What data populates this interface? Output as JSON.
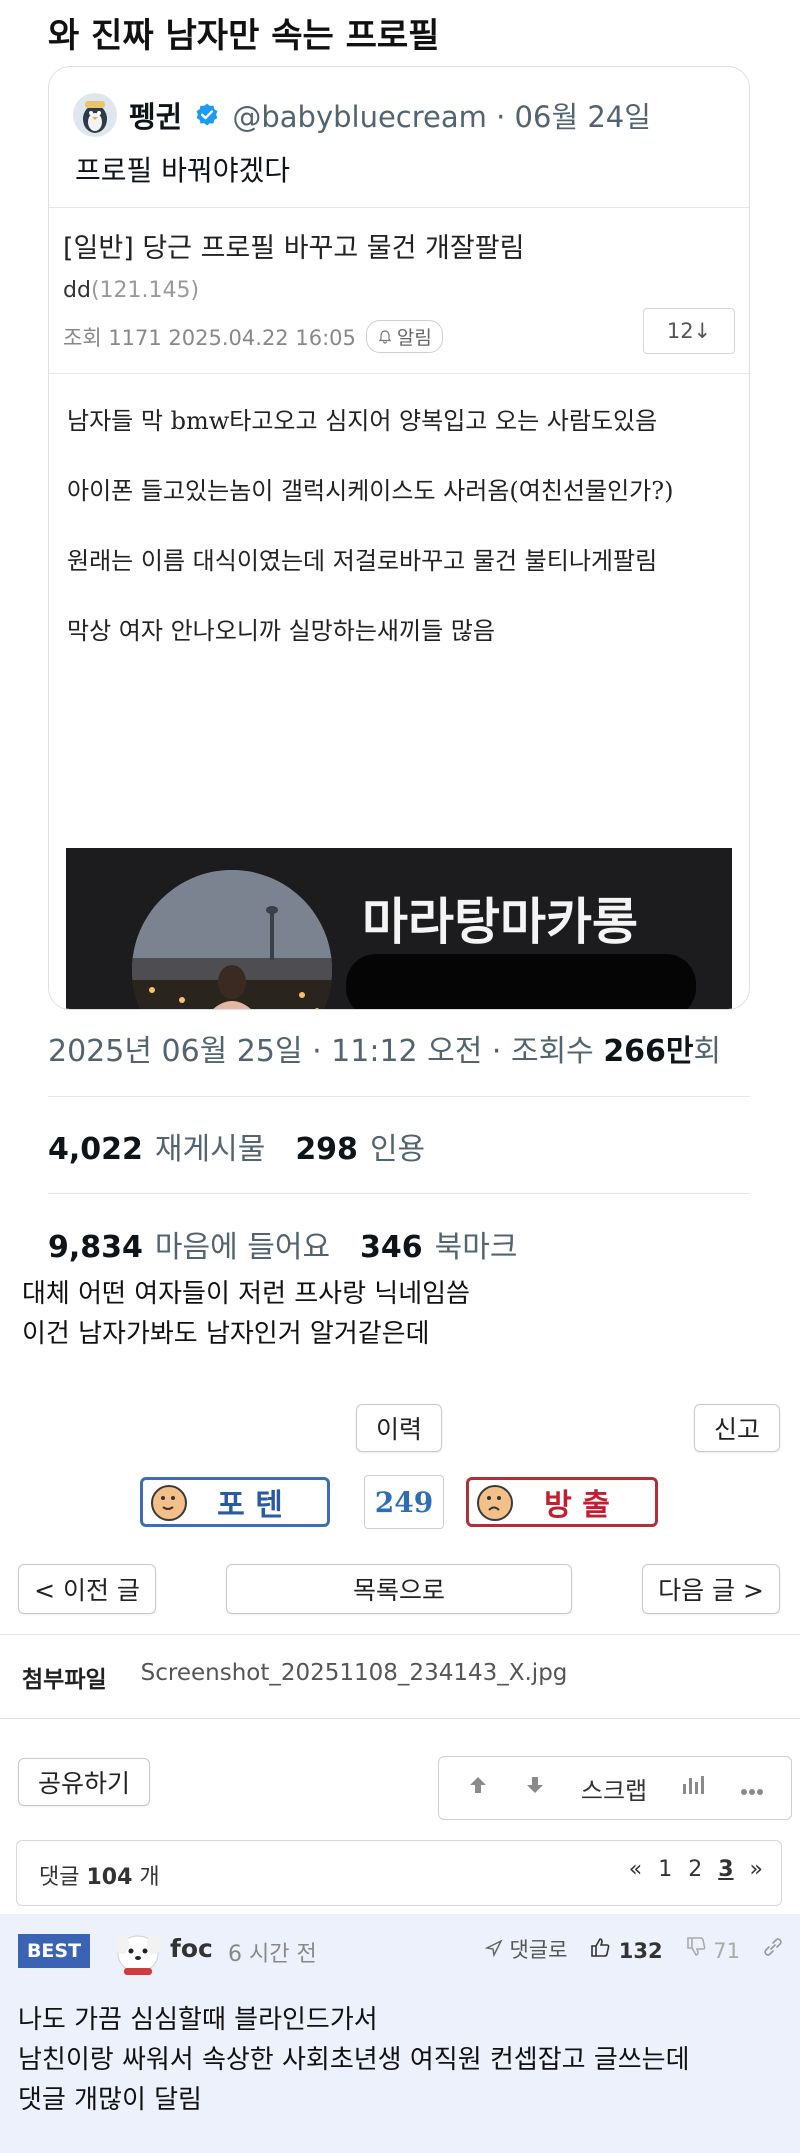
{
  "post": {
    "title": "와 진짜 남자만 속는 프로필"
  },
  "tweet": {
    "name": "펭귄",
    "handle": "@babybluecream · 06월 24일",
    "text": "프로필 바꿔야겠다",
    "timestamp_prefix": "2025년 06월 25일 · 11:12 오전 · 조회수 ",
    "views": "266만",
    "views_suffix": "회",
    "reposts": "4,022",
    "reposts_label": "재게시물",
    "quotes": "298",
    "quotes_label": "인용",
    "likes": "9,834",
    "likes_label": "마음에 들어요",
    "bookmarks": "346",
    "bookmarks_label": "북마크",
    "screenshot": {
      "title": "[일반] 당근 프로필 바꾸고 물건 개잘팔림",
      "author": "dd",
      "author_ip": "(121.145)",
      "meta": "조회 1171  2025.04.22 16:05",
      "alarm": "알림",
      "count": "12↓",
      "lines": [
        "남자들 막 bmw타고오고 심지어 양복입고 오는 사람도있음",
        "아이폰 들고있는놈이 갤럭시케이스도 사러옴(여친선물인가?)",
        "원래는 이름 대식이였는데 저걸로바꾸고 물건 불티나게팔림",
        "막상 여자 안나오니까 실망하는새끼들 많음"
      ],
      "nickname": "마라탕마카롱"
    }
  },
  "caption": {
    "line1": "대체 어떤 여자들이 저런 프사랑 닉네임씀",
    "line2": "이건 남자가봐도 남자인거 알거같은데"
  },
  "buttons": {
    "history": "이력",
    "report": "신고",
    "vote_up": "포 텐",
    "vote_count": "249",
    "vote_down": "방 출",
    "prev": "< 이전 글",
    "list": "목록으로",
    "next": "다음 글 >",
    "share": "공유하기",
    "scrap": "스크랩"
  },
  "attachment": {
    "label": "첨부파일",
    "filename": "Screenshot_20251108_234143_X.jpg"
  },
  "comments": {
    "prefix": "댓글 ",
    "count": "104",
    "suffix": " 개",
    "pages": [
      "«",
      "1",
      "2",
      "3",
      "»"
    ],
    "current_page": "3"
  },
  "best_comment": {
    "badge": "BEST",
    "user": "foc",
    "time": "6 시간 전",
    "reply": "댓글로",
    "upvotes": "132",
    "downvotes": "71",
    "line1": "나도 가끔 심심할때 블라인드가서",
    "line2": "남친이랑 싸워서 속상한 사회초년생 여직원 컨셉잡고 글쓰는데",
    "line3": "댓글 개많이 달림"
  },
  "colors": {
    "verified": "#1d9bf0",
    "vote_up": "#3d6fb0",
    "vote_down": "#b0303a",
    "best_badge": "#3a63b4",
    "best_bg": "#edf1fb"
  }
}
